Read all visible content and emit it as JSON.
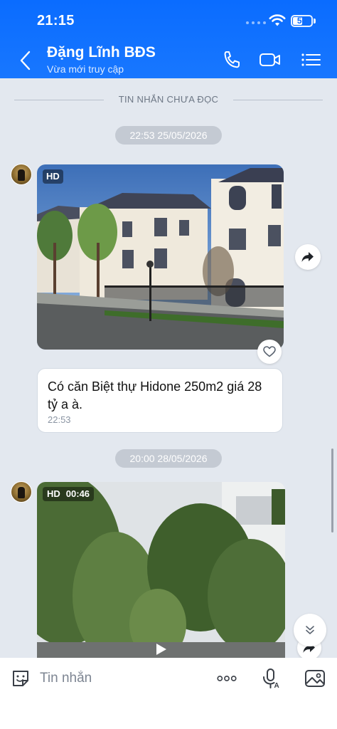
{
  "status_bar": {
    "time": "21:15",
    "battery": "50",
    "battery_level": 0.5
  },
  "header": {
    "contact_name": "Đặng Lĩnh BĐS",
    "contact_status": "Vừa mới truy cập",
    "icons": [
      "back-arrow-icon",
      "phone-icon",
      "video-camera-icon",
      "list-menu-icon"
    ]
  },
  "chat": {
    "unread_divider": "TIN NHẮN CHƯA ĐỌC",
    "groups": [
      {
        "date": "22:53 25/05/2026"
      },
      {
        "date": "20:00 28/05/2026"
      }
    ],
    "photo_message": {
      "badge": "HD"
    },
    "text_message": {
      "text": "Có căn Biệt thự Hidone 250m2 giá 28 tỷ a à.",
      "time": "22:53"
    },
    "video_message": {
      "badge": "HD",
      "duration": "00:46"
    }
  },
  "composer": {
    "placeholder": "Tin nhắn",
    "icons": [
      "sticker-icon",
      "more-dots-icon",
      "voice-icon",
      "gallery-icon"
    ]
  },
  "colors": {
    "accent": "#0a6cff",
    "chat_bg": "#e3e8ef",
    "pill": "#c4cad3"
  }
}
